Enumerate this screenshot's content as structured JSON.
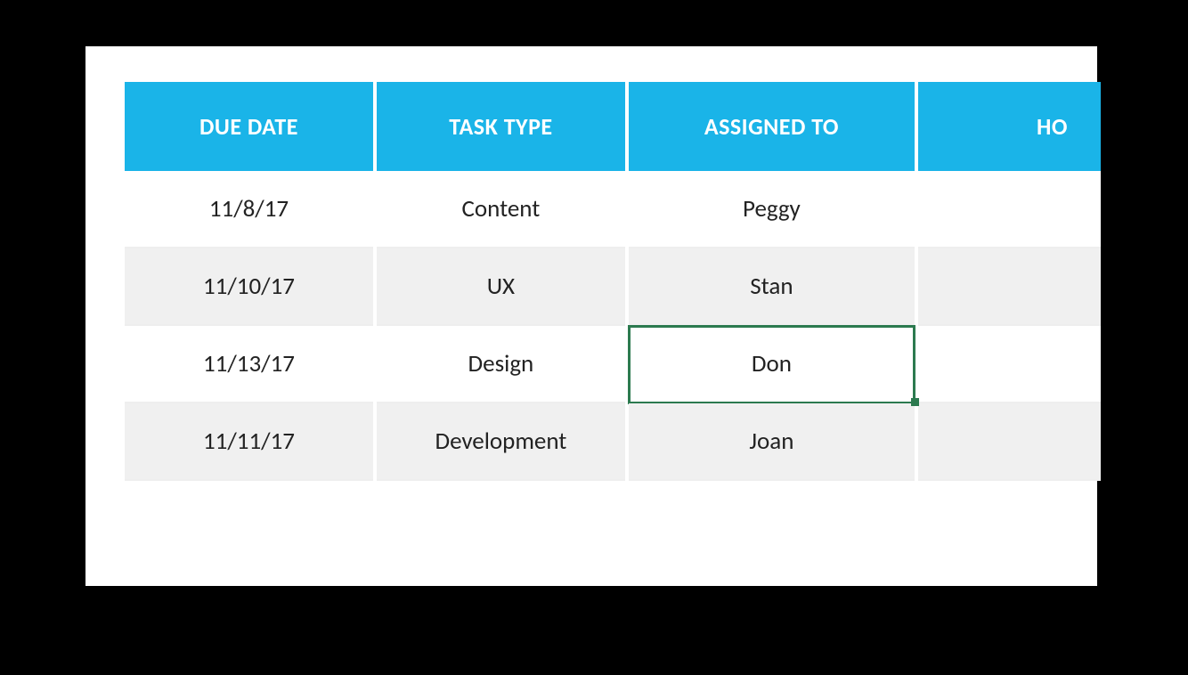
{
  "table": {
    "headers": [
      "DUE DATE",
      "TASK TYPE",
      "ASSIGNED TO",
      "HO"
    ],
    "rows": [
      {
        "due_date": "11/8/17",
        "task_type": "Content",
        "assigned_to": "Peggy",
        "hours": ""
      },
      {
        "due_date": "11/10/17",
        "task_type": "UX",
        "assigned_to": "Stan",
        "hours": ""
      },
      {
        "due_date": "11/13/17",
        "task_type": "Design",
        "assigned_to": "Don",
        "hours": ""
      },
      {
        "due_date": "11/11/17",
        "task_type": "Development",
        "assigned_to": "Joan",
        "hours": ""
      }
    ],
    "selected": {
      "row": 2,
      "col": "assigned_to"
    }
  }
}
